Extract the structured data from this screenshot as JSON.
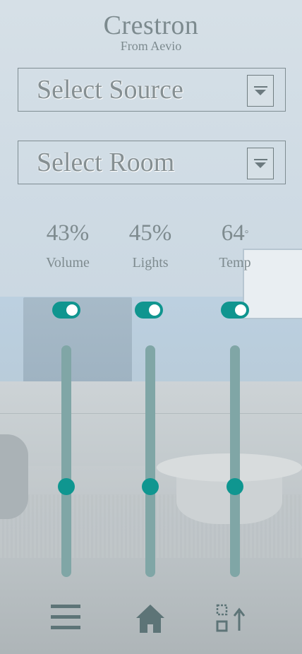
{
  "header": {
    "title": "Crestron",
    "subtitle": "From Aevio"
  },
  "selects": {
    "source_label": "Select Source",
    "room_label": "Select Room"
  },
  "controls": [
    {
      "value": "43%",
      "label": "Volume",
      "toggle_on": true,
      "level": 0.39
    },
    {
      "value": "45%",
      "label": "Lights",
      "toggle_on": true,
      "level": 0.39
    },
    {
      "value": "64",
      "unit": "°",
      "label": "Temp",
      "toggle_on": true,
      "level": 0.39
    }
  ],
  "nav": {
    "icons": [
      "menu-icon",
      "home-icon",
      "share-upload-icon"
    ]
  },
  "colors": {
    "accent": "#10958f",
    "track": "#80a6a6",
    "text": "#7e8b8f"
  }
}
